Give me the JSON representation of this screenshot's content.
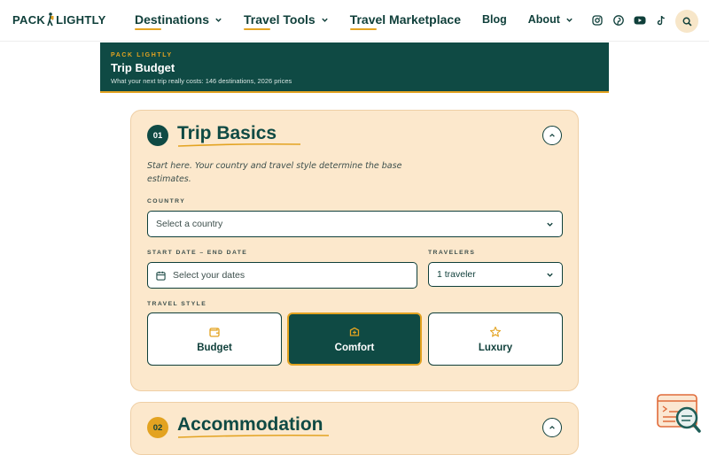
{
  "header": {
    "logo_text_left": "PACK",
    "logo_text_right": "LIGHTLY",
    "nav": [
      {
        "label": "Destinations",
        "has_dropdown": true,
        "underlined": true
      },
      {
        "label": "Travel Tools",
        "has_dropdown": true,
        "underlined": true
      },
      {
        "label": "Travel Marketplace",
        "has_dropdown": false,
        "underlined": true
      },
      {
        "label": "Blog",
        "has_dropdown": false,
        "underlined": false
      },
      {
        "label": "About",
        "has_dropdown": true,
        "underlined": false
      }
    ],
    "socials": [
      "instagram-icon",
      "pinterest-icon",
      "youtube-icon",
      "tiktok-icon"
    ],
    "search_icon": "search-icon"
  },
  "banner": {
    "kicker": "PACK LIGHTLY",
    "title": "Trip Budget",
    "subtitle": "What your next trip really costs: 146 destinations, 2026 prices"
  },
  "trip_basics": {
    "step": "01",
    "title": "Trip Basics",
    "intro": "Start here. Your country and travel style determine the base estimates.",
    "country_label": "COUNTRY",
    "country_placeholder": "Select a country",
    "dates_label": "START DATE – END DATE",
    "dates_placeholder": "Select your dates",
    "travelers_label": "TRAVELERS",
    "travelers_value": "1 traveler",
    "style_label": "TRAVEL STYLE",
    "styles": [
      {
        "label": "Budget",
        "icon": "wallet-icon",
        "selected": false
      },
      {
        "label": "Comfort",
        "icon": "suitcase-icon",
        "selected": true
      },
      {
        "label": "Luxury",
        "icon": "star-icon",
        "selected": false
      }
    ]
  },
  "accommodation": {
    "step": "02",
    "title": "Accommodation"
  },
  "colors": {
    "primary": "#0f4a44",
    "accent": "#e3a321",
    "card_bg": "#fce8cc"
  }
}
